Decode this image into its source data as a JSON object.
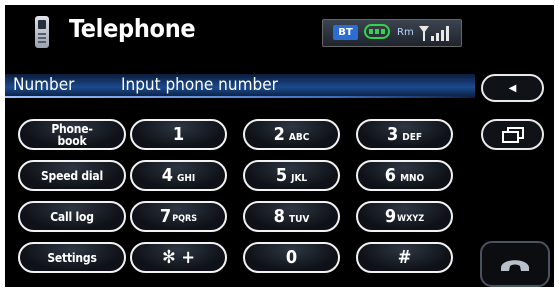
{
  "header": {
    "title": "Telephone",
    "status": {
      "bluetooth_label": "BT",
      "roaming_label": "Rm",
      "bluetooth_color": "#2b6dd4",
      "battery_color": "#35d24a"
    }
  },
  "number_bar": {
    "label": "Number",
    "placeholder": "Input phone number"
  },
  "side_buttons": {
    "phonebook_line1": "Phone-",
    "phonebook_line2": "book",
    "speed_dial": "Speed dial",
    "call_log": "Call log",
    "settings": "Settings"
  },
  "keypad": [
    {
      "digit": "1",
      "letters": ""
    },
    {
      "digit": "2",
      "letters": "ABC"
    },
    {
      "digit": "3",
      "letters": "DEF"
    },
    {
      "digit": "4",
      "letters": "GHI"
    },
    {
      "digit": "5",
      "letters": "JKL"
    },
    {
      "digit": "6",
      "letters": "MNO"
    },
    {
      "digit": "7",
      "letters": "PQRS"
    },
    {
      "digit": "8",
      "letters": "TUV"
    },
    {
      "digit": "9",
      "letters": "WXYZ"
    },
    {
      "digit": "✻ +",
      "letters": ""
    },
    {
      "digit": "0",
      "letters": ""
    },
    {
      "digit": "#",
      "letters": ""
    }
  ],
  "right_controls": {
    "back_icon": "left-arrow-icon",
    "windows_icon": "overlapping-windows-icon",
    "call_icon": "handset-icon"
  }
}
